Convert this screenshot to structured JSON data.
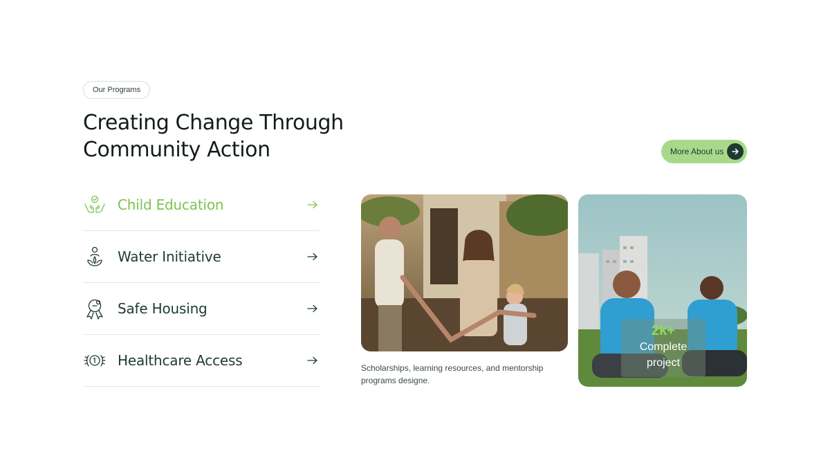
{
  "eyebrow": "Our Programs",
  "headline": {
    "line1": "Creating Change Through",
    "line2": "Community Action"
  },
  "more_button": {
    "label": "More About us",
    "icon": "arrow-right-icon"
  },
  "programs": [
    {
      "label": "Child Education",
      "icon": "hands-heart-icon",
      "active": true
    },
    {
      "label": "Water Initiative",
      "icon": "person-lotus-icon",
      "active": false
    },
    {
      "label": "Safe Housing",
      "icon": "award-ribbon-icon",
      "active": false
    },
    {
      "label": "Healthcare Access",
      "icon": "medal-laurel-icon",
      "active": false
    }
  ],
  "caption": "Scholarships, learning resources, and mentorship programs designe.",
  "stat": {
    "value": "2k+",
    "label_line1": "Complete",
    "label_line2": "project"
  },
  "colors": {
    "accent_green": "#7cc24f",
    "button_green": "#a8d98a",
    "dark_green": "#1f3a33",
    "heading": "#121c19"
  }
}
